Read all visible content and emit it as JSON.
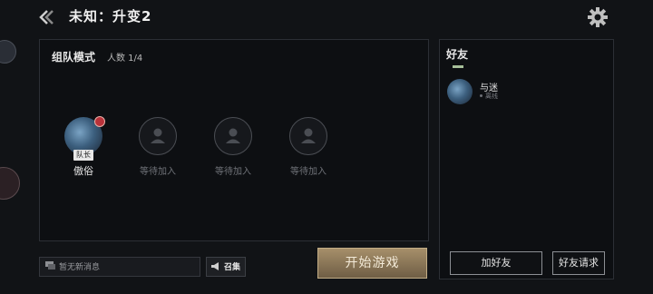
{
  "header": {
    "title": "未知：升变2",
    "back_icon": "back-chevron-icon",
    "settings_icon": "gear-icon"
  },
  "team": {
    "mode_label": "组队模式",
    "count_label": "人数 1/4",
    "leader": {
      "name": "傲俗",
      "tag": "队长"
    },
    "empty_slots": [
      {
        "label": "等待加入"
      },
      {
        "label": "等待加入"
      },
      {
        "label": "等待加入"
      }
    ]
  },
  "chat": {
    "placeholder": "暂无新消息",
    "recruit_label": "召集"
  },
  "start_button": {
    "label": "开始游戏",
    "color": "#8c7a5a"
  },
  "friends": {
    "title": "好友",
    "list": [
      {
        "name": "与迷",
        "status": "离线"
      }
    ],
    "add_friend_label": "加好友",
    "friend_request_label": "好友请求"
  }
}
